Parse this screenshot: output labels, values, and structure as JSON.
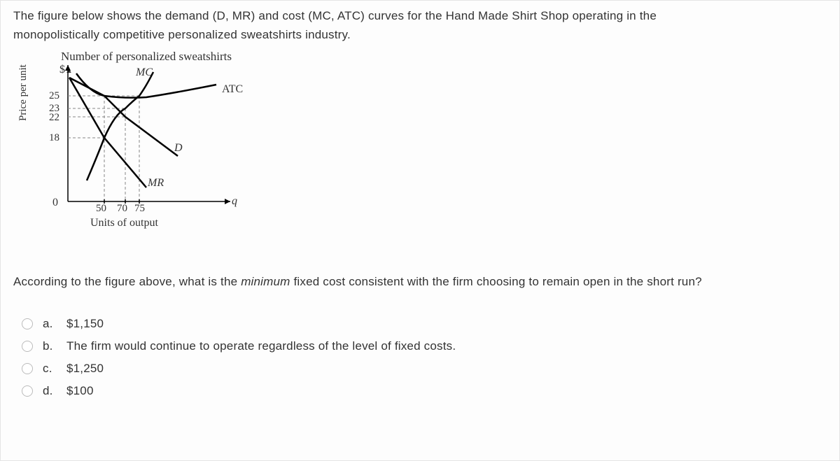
{
  "prompt_line1": "The figure below shows the demand (D, MR) and cost (MC, ATC) curves for the Hand Made Shirt Shop operating in the",
  "prompt_line2": "monopolistically competitive personalized sweatshirts industry.",
  "figure": {
    "title": "Number of personalized sweatshirts",
    "y_symbol": "$",
    "y_label": "Price per unit",
    "x_label": "Units of output",
    "x_end": "q",
    "origin": "0",
    "y_ticks": [
      "25",
      "23",
      "22",
      "18"
    ],
    "x_ticks": [
      "50",
      "70",
      "75"
    ],
    "curves": {
      "mc": "MC",
      "atc": "ATC",
      "d": "D",
      "mr": "MR"
    }
  },
  "question_prefix": "According to the figure above, what is the ",
  "question_em": "minimum",
  "question_suffix": " fixed cost consistent with the firm choosing to remain open in the short run?",
  "options": [
    {
      "letter": "a.",
      "text": "$1,150"
    },
    {
      "letter": "b.",
      "text": "The firm would continue to operate regardless of the level of fixed costs."
    },
    {
      "letter": "c.",
      "text": "$1,250"
    },
    {
      "letter": "d.",
      "text": "$100"
    }
  ],
  "chart_data": {
    "type": "line",
    "title": "Number of personalized sweatshirts",
    "xlabel": "Units of output",
    "ylabel": "Price per unit ($)",
    "series": [
      {
        "name": "MC",
        "x": [
          30,
          50,
          70,
          75,
          100
        ],
        "y": [
          8,
          18,
          23,
          25,
          35
        ]
      },
      {
        "name": "ATC",
        "x": [
          20,
          50,
          75,
          120
        ],
        "y": [
          40,
          25,
          25,
          32
        ]
      },
      {
        "name": "D",
        "x": [
          0,
          50,
          70,
          120
        ],
        "y": [
          35,
          25,
          22,
          12
        ]
      },
      {
        "name": "MR",
        "x": [
          0,
          50,
          80
        ],
        "y": [
          35,
          18,
          5
        ]
      }
    ],
    "y_ticks": [
      18,
      22,
      23,
      25
    ],
    "x_ticks": [
      50,
      70,
      75
    ]
  }
}
